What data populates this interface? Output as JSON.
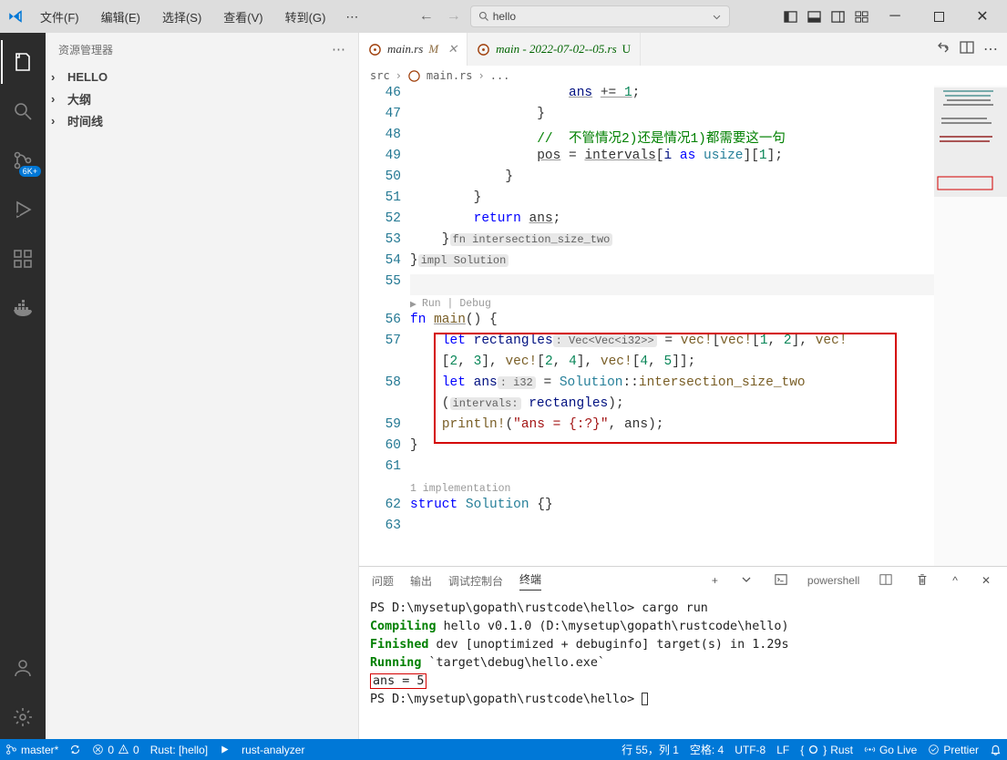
{
  "menu": {
    "file": "文件(F)",
    "edit": "编辑(E)",
    "select": "选择(S)",
    "view": "查看(V)",
    "goto": "转到(G)"
  },
  "search": {
    "text": "hello"
  },
  "sidebar": {
    "title": "资源管理器",
    "sections": [
      "HELLO",
      "大纲",
      "时间线"
    ]
  },
  "tabs": {
    "t1": {
      "name": "main.rs",
      "mod": "M"
    },
    "t2": {
      "name": "main - 2022-07-02--05.rs",
      "mod": "U"
    }
  },
  "breadcrumb": {
    "a": "src",
    "b": "main.rs",
    "c": "..."
  },
  "code": {
    "codelens1": "Run | Debug",
    "impl_hint": "impl Solution",
    "fn_hint": "fn intersection_size_two",
    "comment1": "//  不管情况2)还是情况1)都需要这一句",
    "ans_plus": "ans += 1;",
    "pos_eq": "pos",
    "intervals": "intervals",
    "i_as": "i as usize",
    "one": "1",
    "return_ans": "return",
    "ans": "ans",
    "main": "main",
    "let_rect": "let",
    "rectangles": "rectangles",
    "vec_t": "Vec<Vec<i32>>",
    "vec1": "vec!",
    "arr1": "[1, 2]",
    "arr2": "[2, 3]",
    "arr3": "[2, 4]",
    "arr4": "[4, 5]",
    "let_ans": "let",
    "ans_v": "ans",
    "i32": "i32",
    "solution": "Solution",
    "method": "intersection_size_two",
    "param_hint": "intervals:",
    "rect_arg": "rectangles",
    "println": "println!",
    "fmt": "\"ans = {:?}\"",
    "impl_codelens": "1 implementation",
    "struct": "struct",
    "sol": "Solution",
    "braces": "{}"
  },
  "lines": {
    "l46": "46",
    "l47": "47",
    "l48": "48",
    "l49": "49",
    "l50": "50",
    "l51": "51",
    "l52": "52",
    "l53": "53",
    "l54": "54",
    "l55": "55",
    "l56": "56",
    "l57": "57",
    "l58": "58",
    "l59": "59",
    "l60": "60",
    "l61": "61",
    "l62": "62",
    "l63": "63"
  },
  "panel": {
    "tabs": [
      "问题",
      "输出",
      "调试控制台",
      "终端"
    ],
    "shell": "powershell"
  },
  "term": {
    "l1": "PS D:\\mysetup\\gopath\\rustcode\\hello> cargo run",
    "l2a": "Compiling",
    "l2b": " hello v0.1.0 (D:\\mysetup\\gopath\\rustcode\\hello)",
    "l3a": "Finished",
    "l3b": " dev [unoptimized + debuginfo] target(s) in 1.29s",
    "l4a": "Running",
    "l4b": " `target\\debug\\hello.exe`",
    "l5": "ans = 5",
    "l6": "PS D:\\mysetup\\gopath\\rustcode\\hello> "
  },
  "status": {
    "branch": "master*",
    "sync": "",
    "errors": "0",
    "warnings": "0",
    "rust": "Rust: [hello]",
    "ra": "rust-analyzer",
    "pos": "行 55，列 1",
    "spaces": "空格: 4",
    "enc": "UTF-8",
    "eol": "LF",
    "lang": "Rust",
    "golive": "Go Live",
    "prettier": "Prettier"
  }
}
